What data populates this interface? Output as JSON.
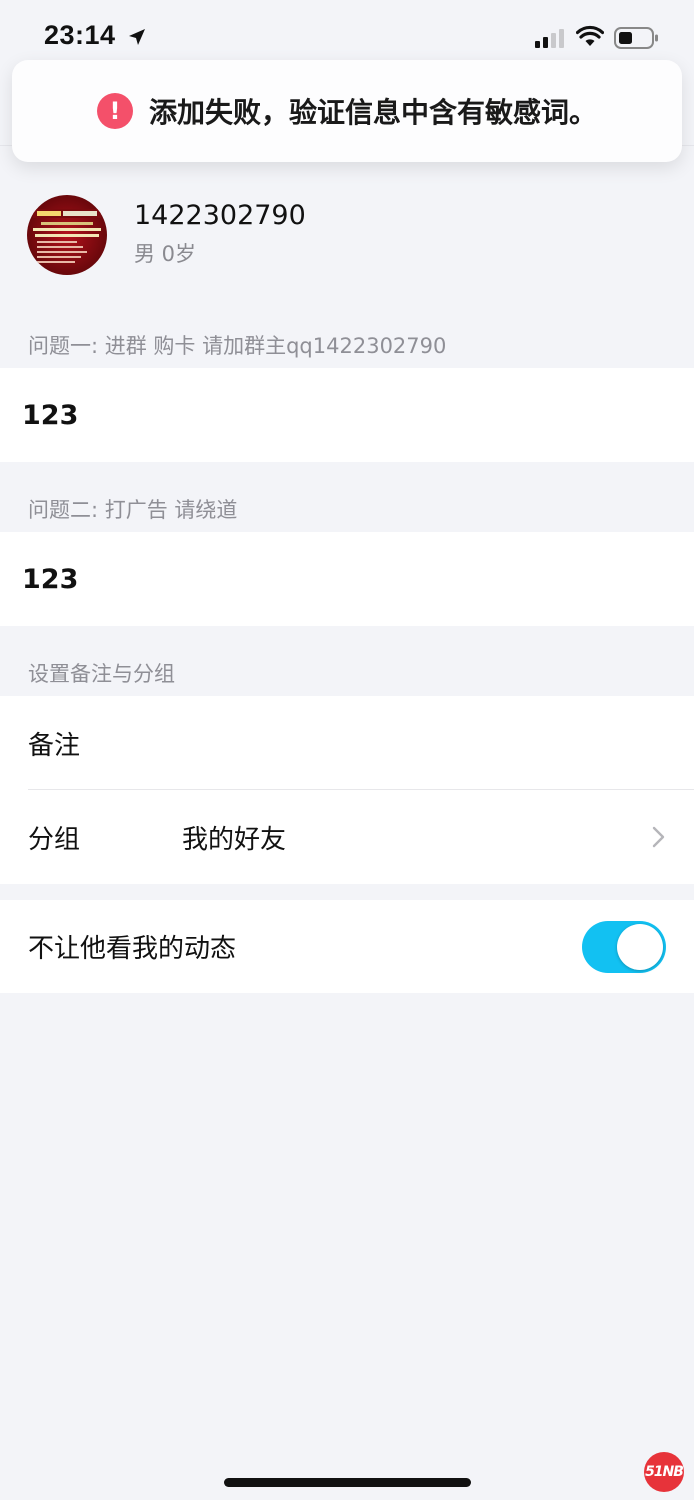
{
  "status_bar": {
    "time": "23:14"
  },
  "toast": {
    "text": "添加失败，验证信息中含有敏感词。"
  },
  "profile": {
    "name": "1422302790",
    "meta": "男 0岁"
  },
  "questions": [
    {
      "label": "问题一: 进群 购卡 请加群主qq1422302790",
      "answer": "123"
    },
    {
      "label": "问题二: 打广告  请绕道",
      "answer": "123"
    }
  ],
  "settings": {
    "section_label": "设置备注与分组",
    "remark_label": "备注",
    "group_label": "分组",
    "group_value": "我的好友"
  },
  "privacy": {
    "label": "不让他看我的动态",
    "enabled": true
  },
  "watermark": {
    "text": "51NB"
  },
  "colors": {
    "toggle_on": "#12c1f2",
    "error_icon": "#f4506a",
    "background": "#f3f4f8"
  }
}
